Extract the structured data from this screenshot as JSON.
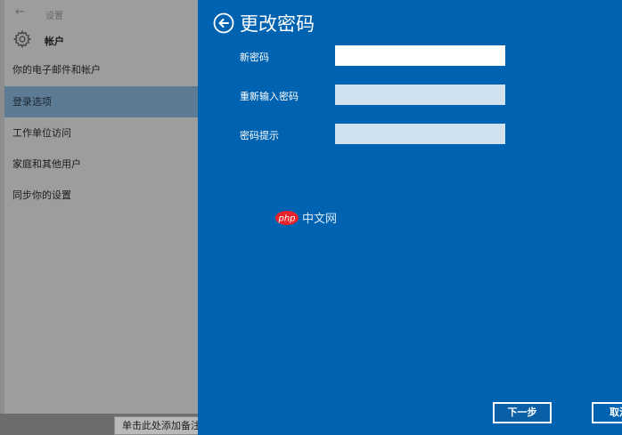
{
  "settings": {
    "title": "设置",
    "section_title": "帐户",
    "items": [
      {
        "label": "你的电子邮件和帐户"
      },
      {
        "label": "登录选项"
      },
      {
        "label": "工作单位访问"
      },
      {
        "label": "家庭和其他用户"
      },
      {
        "label": "同步你的设置"
      }
    ],
    "active_index": 1,
    "note_text": "单击此处添加备注"
  },
  "dialog": {
    "title": "更改密码",
    "fields": [
      {
        "label": "新密码",
        "value": "",
        "placeholder": ""
      },
      {
        "label": "重新输入密码",
        "value": "",
        "placeholder": ""
      },
      {
        "label": "密码提示",
        "value": "",
        "placeholder": ""
      }
    ],
    "next_label": "下一步",
    "cancel_label": "取消"
  },
  "watermark": {
    "logo_text": "php",
    "site_text": "中文网"
  },
  "colors": {
    "dialog_bg": "#0063b1",
    "active_field": "#ffffff",
    "inactive_field": "#cfe0ee",
    "overlay": "#9d9d9d"
  },
  "icons": {
    "back": "back-arrow-icon",
    "gear": "gear-icon",
    "dialog_back": "circle-back-arrow-icon"
  }
}
